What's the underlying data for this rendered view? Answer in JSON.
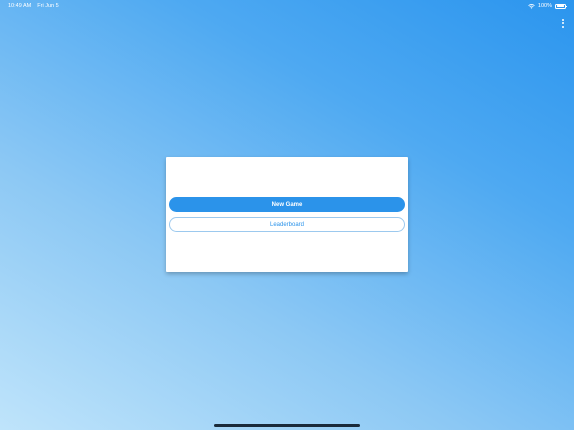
{
  "status_bar": {
    "time": "10:49 AM",
    "date": "Fri Jun 5",
    "battery": "100%",
    "icons": [
      "wifi-icon",
      "battery-icon"
    ]
  },
  "menu": {
    "icon": "more-vertical-icon"
  },
  "dialog": {
    "new_game_label": "New Game",
    "leaderboard_label": "Leaderboard"
  },
  "colors": {
    "accent": "#2b93ea",
    "background_start": "#bfe4fb",
    "background_end": "#2b95ee"
  }
}
